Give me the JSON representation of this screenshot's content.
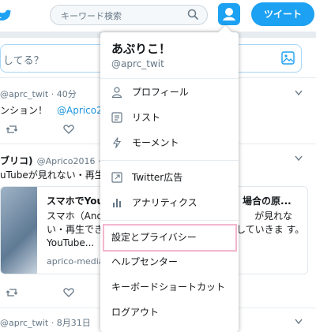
{
  "topbar": {
    "search_placeholder": "キーワード検索",
    "tweet_button": "ツイート"
  },
  "compose": {
    "placeholder": "してる？"
  },
  "tweets": [
    {
      "meta": "@aprc_twit · 40分",
      "text": "ンション！",
      "mention": "@Aprico2"
    },
    {
      "author": "ブリコ)",
      "meta": "@Aprico2016 · 9",
      "text": "uTubeが見れない・再生",
      "card": {
        "title": "スマホでYou",
        "title_tail": "場合の原...",
        "desc": "スマホ（And　　　　　　　　　　　　　　　　が見れな い・再生でき　　　　　　　　　　　　　　していきま す。YouTube...",
        "domain": "aprico-media"
      }
    },
    {
      "meta": "@aprc_twit · 8月31日"
    }
  ],
  "menu": {
    "name": "あぷりこ！",
    "handle": "@aprc_twit",
    "items": [
      {
        "label": "プロフィール",
        "icon": "person-icon"
      },
      {
        "label": "リスト",
        "icon": "list-icon"
      },
      {
        "label": "モーメント",
        "icon": "lightning-icon"
      },
      {
        "label": "Twitter広告",
        "icon": "external-link-icon"
      },
      {
        "label": "アナリティクス",
        "icon": "bar-chart-icon"
      },
      {
        "label": "設定とプライバシー"
      },
      {
        "label": "ヘルプセンター"
      },
      {
        "label": "キーボードショートカット"
      },
      {
        "label": "ログアウト"
      }
    ]
  },
  "colors": {
    "accent": "#1da1f2",
    "highlight": "#f4b6cf",
    "mention": "#1b95e0"
  }
}
